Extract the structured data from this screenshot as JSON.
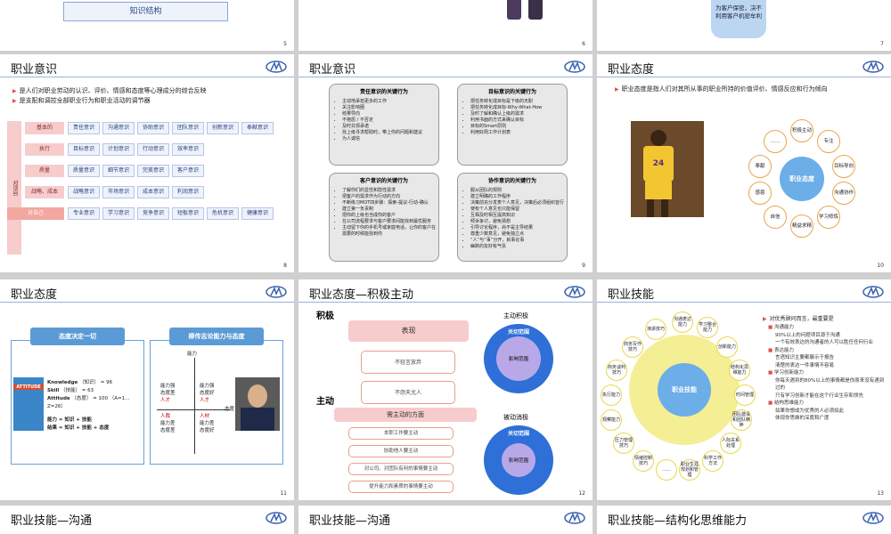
{
  "slides": {
    "s5": {
      "num": "5",
      "knowledge_btn": "知识结构"
    },
    "s6": {
      "num": "6"
    },
    "s7": {
      "num": "7",
      "bubble": "为客户保密，决不利用客户机密牟利"
    },
    "s8": {
      "title": "职业意识",
      "num": "8",
      "bullets": [
        "是人们对职业劳动的认识、评价、情感和态度等心理成分的综合反映",
        "是支配和调控全部职业行为和职业活动的调节器"
      ],
      "side_label": "对项目",
      "bottom_label": "对自己",
      "rows": [
        {
          "label": "基本的",
          "cells": [
            "责任意识",
            "沟通意识",
            "协助意识",
            "团队意识",
            "创新意识",
            "奉献意识"
          ]
        },
        {
          "label": "执行",
          "cells": [
            "目标意识",
            "计划意识",
            "行动意识",
            "效率意识"
          ]
        },
        {
          "label": "质量",
          "cells": [
            "质量意识",
            "细节意识",
            "完美意识",
            "客户意识"
          ]
        },
        {
          "label": "战略、成本",
          "cells": [
            "战略意识",
            "市场意识",
            "成本意识",
            "利润意识"
          ]
        },
        {
          "label": "对自己",
          "cells": [
            "专业意识",
            "学习意识",
            "竞争意识",
            "短板意识",
            "危机意识",
            "健康意识"
          ]
        }
      ]
    },
    "s9": {
      "title": "职业意识",
      "num": "9",
      "boxes": [
        {
          "head": "责任意识的关键行为",
          "items": [
            "主动地承担更多的工作",
            "关注影响圈",
            "结果导向",
            "不抱怨 / 不否定",
            "及时兑现承诺",
            "找上级寻求帮助时，带上你的问题和建议",
            "为人诚信"
          ]
        },
        {
          "head": "目标意识的关键行为",
          "items": [
            "把任务转化成目标是下级的天职",
            "把任务转化成目标-Why-What-How",
            "及时了解和确认上级的需求",
            "利用书面的方式来确认目标",
            "目标的Smart原则",
            "利用好周工作计划表"
          ]
        },
        {
          "head": "客户意识的关键行为",
          "items": [
            "了解你们的显性和隐性需求",
            "把客户的需求作为行动的方向",
            "不断练习MOT四步骤：探索-提议-行动-确认",
            "建立第一负责制",
            "把你的上级也当成你的客户",
            "在公司流程要求与客户要求间能找到最优服务",
            "主动留下你的手机号或家庭电话，让你的客户在需要的时候能找到你"
          ]
        },
        {
          "head": "协作意识的关键行为",
          "items": [
            "服从团队的规则",
            "建立明确的工作程序",
            "决策前充分发表个人意见，决策后必须组织皆行",
            "使有个人意见也只能保留",
            "互相及时相互提高知识",
            "倾诉争讨，避免猜想",
            "引导讨论程序，尚不是主导结果",
            "尊重少数意见，避免独立点",
            "“人”与“事”分开，就事论事",
            "幽默的友好有气氛"
          ]
        }
      ]
    },
    "s10": {
      "title": "职业态度",
      "num": "10",
      "bullet": "职业态度是指人们对其所从事的职业所持的价值评价、情感反应和行为倾向",
      "center": "职业态度",
      "petals": [
        "积极主动",
        "专注",
        "目标导向",
        "沟通协作",
        "学习修炼",
        "精益求精",
        "自信",
        "感恩",
        "奉献",
        "……"
      ]
    },
    "s11": {
      "title": "职业态度",
      "num": "11",
      "btn_left": "态度决定一切",
      "btn_right": "柳传志论能力与态度",
      "book": "ATTITUDE",
      "formula": [
        [
          "Knowledge",
          "（知识）",
          "=",
          "96"
        ],
        [
          "Skill",
          "（技能）",
          "=",
          "63"
        ],
        [
          "Attitude",
          "（态度）",
          "=",
          "100"
        ]
      ],
      "formula_note": "（A=1…Z=26）",
      "result1": "能力 = 知识 + 技能",
      "result2": "结果 = 知识 + 技能 + 态度",
      "axis_y": "能力",
      "axis_x": "态度",
      "quad_tl": "能力强",
      "quad_tl2": "态度差",
      "quad_tr": "能力强",
      "quad_tr2": "态度好",
      "quad_bl": "能力差",
      "quad_bl2": "态度差",
      "quad_br": "能力差",
      "quad_br2": "态度好",
      "talent_left": "人才",
      "talent_left2": "人裁",
      "talent_right": "人才",
      "talent_right2": "人材"
    },
    "s12": {
      "title": "职业态度—积极主动",
      "num": "12",
      "label1": "积极",
      "label2": "主动",
      "top_box": "表现",
      "box1": "不轻言放弃",
      "box2": "不怨天尤人",
      "mid_box": "需主动的方面",
      "items": [
        "本职工作要主动",
        "协助他人要主动",
        "对公司、对团队有利的事情要主动",
        "提升能力和素质的事情要主动"
      ],
      "circle1_title": "主动积极",
      "circle1_ring": "关切范围",
      "circle1_inner": "影响范围",
      "circle2_title": "被动消极",
      "circle2_ring": "关切范围",
      "circle2_inner": "影响范围"
    },
    "s13": {
      "title": "职业技能",
      "num": "13",
      "center": "职业技能",
      "petals": [
        "沟通表达能力",
        "学习整合能力",
        "创新能力",
        "结构化思维能力",
        "时间管理",
        "团队建设和团队精神",
        "人际关系处理",
        "科学工作方法",
        "职业生涯规划和管理",
        "……",
        "情绪控制技巧",
        "压力管理技巧",
        "观察能力",
        "执行能力",
        "商务谈判技巧",
        "商务写作技巧",
        "演讲技巧"
      ],
      "intro": "对优秀顾问而言，最重要是",
      "groups": [
        {
          "head": "沟通能力",
          "items": [
            "90%以上的问题项目源于沟通",
            "一个有效表达的沟通者的人可以胜任任何行业"
          ]
        },
        {
          "head": "表达能力",
          "items": [
            "言语知识主要都展示于报告",
            "清楚的表达一件事情不容易"
          ]
        },
        {
          "head": "学习创新能力",
          "items": [
            "你每天遇到的80%以上的事情都是你原来没有遇到过的",
            "只有学习创新才能在这个行业生存和领先"
          ]
        },
        {
          "head": "结构思维能力",
          "items": [
            "如果你想成为优秀的人必须如此",
            "体现你思维的深度和广度"
          ]
        }
      ]
    },
    "s14": {
      "title": "职业技能—沟通"
    },
    "s15": {
      "title": "职业技能—沟通"
    },
    "s16": {
      "title": "职业技能—结构化思维能力"
    }
  }
}
